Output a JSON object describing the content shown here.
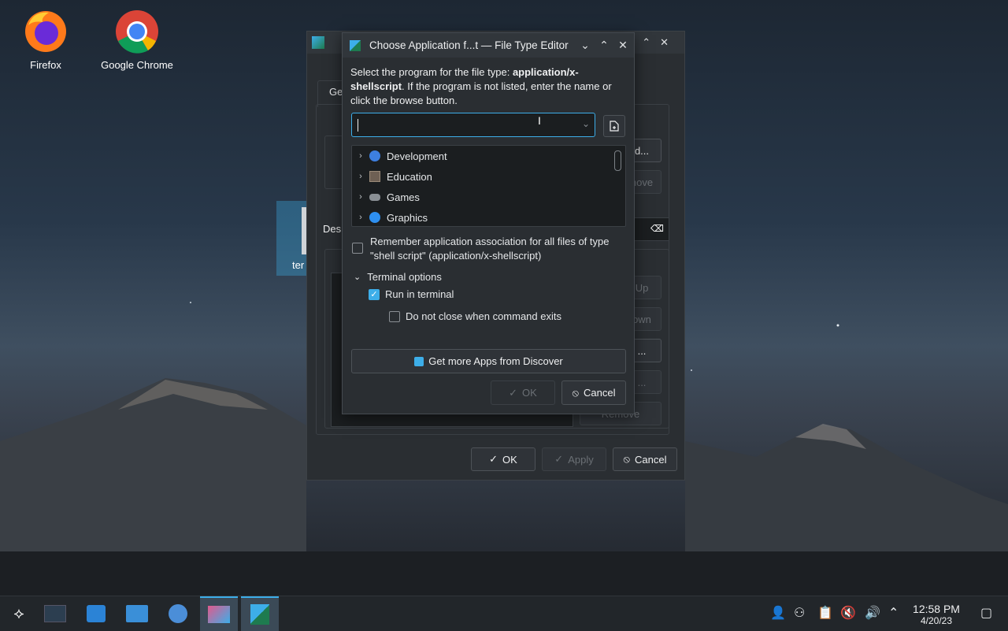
{
  "desktop": {
    "icons": [
      {
        "label": "Firefox"
      },
      {
        "label": "Google Chrome"
      }
    ],
    "selected_icon_label": "ter"
  },
  "background_window": {
    "tab_label": "Ge",
    "desc_label": "Des",
    "buttons": {
      "add": "d...",
      "remove_top": "nove",
      "up": "Up",
      "down": "own",
      "edit": "...",
      "remove2": "...",
      "remove_bottom": "Remove",
      "ok": "OK",
      "apply": "Apply",
      "cancel": "Cancel"
    }
  },
  "dialog": {
    "title": "Choose Application f...t — File Type Editor",
    "description_prefix": "Select the program for the file type: ",
    "mime_type": "application/x-shellscript",
    "description_suffix": ". If the program is not listed, enter the name or click the browse button.",
    "combo_value": "",
    "tree_items": [
      {
        "label": "Development",
        "icon": "development-icon",
        "color": "#3d7fe0"
      },
      {
        "label": "Education",
        "icon": "education-icon",
        "color": "#6e6054"
      },
      {
        "label": "Games",
        "icon": "games-icon",
        "color": "#8a8f94"
      },
      {
        "label": "Graphics",
        "icon": "graphics-icon",
        "color": "#2e8ff0"
      }
    ],
    "remember_label": "Remember application association for all files of type \"shell script\" (application/x-shellscript)",
    "remember_checked": false,
    "terminal_options_label": "Terminal options",
    "run_in_terminal_label": "Run in terminal",
    "run_in_terminal_checked": true,
    "no_close_label": "Do not close when command exits",
    "no_close_checked": false,
    "discover_button": "Get more Apps from Discover",
    "ok_label": "OK",
    "cancel_label": "Cancel"
  },
  "taskbar": {
    "time": "12:58 PM",
    "date": "4/20/23"
  },
  "colors": {
    "accent": "#3daee9",
    "panel": "#2a2e32",
    "taskbar": "#22262a"
  }
}
